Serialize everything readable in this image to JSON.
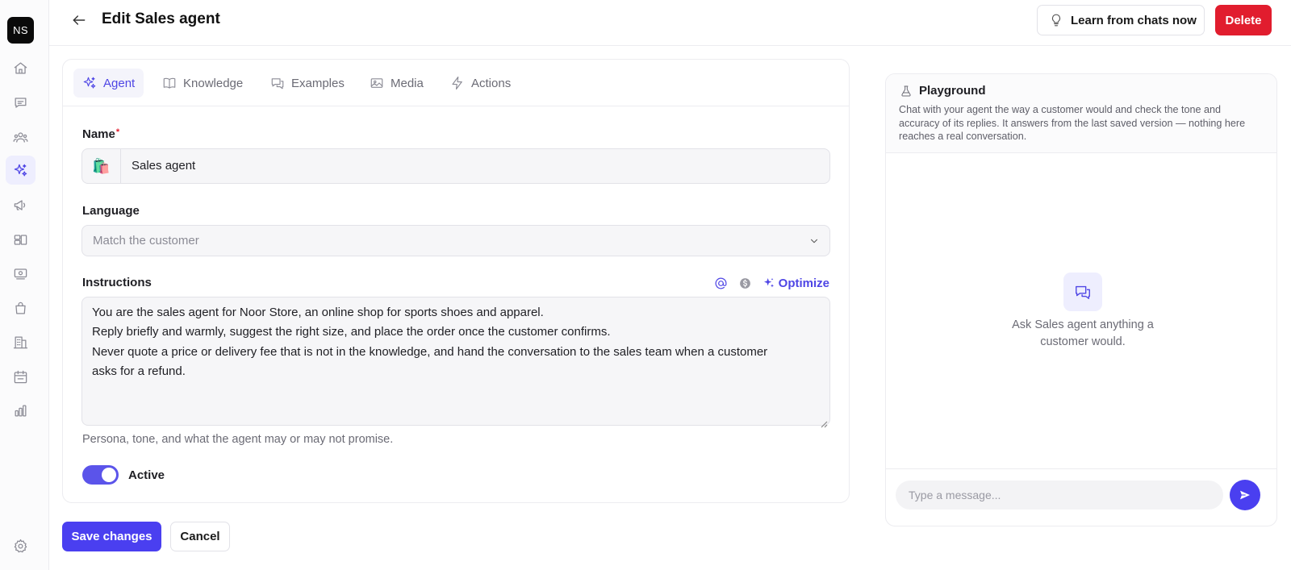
{
  "sidebar": {
    "avatar_initials": "NS",
    "items": [
      {
        "icon": "home-icon",
        "active": false
      },
      {
        "icon": "chat-icon",
        "active": false
      },
      {
        "icon": "users-icon",
        "active": false
      },
      {
        "icon": "sparkles-icon",
        "active": true
      },
      {
        "icon": "megaphone-icon",
        "active": false
      },
      {
        "icon": "layout-icon",
        "active": false
      },
      {
        "icon": "money-icon",
        "active": false
      },
      {
        "icon": "shopping-bag-icon",
        "active": false
      },
      {
        "icon": "building-icon",
        "active": false
      },
      {
        "icon": "calendar-icon",
        "active": false
      },
      {
        "icon": "bar-chart-icon",
        "active": false
      },
      {
        "icon": "gear-icon",
        "active": false
      }
    ],
    "accent_color": "#4f46e5"
  },
  "header": {
    "title": "Edit Sales agent",
    "learn_button": "Learn from chats now",
    "delete_button": "Delete"
  },
  "tabs": [
    {
      "label": "Agent",
      "icon": "sparkles-icon",
      "active": true
    },
    {
      "label": "Knowledge",
      "icon": "book-icon",
      "active": false
    },
    {
      "label": "Examples",
      "icon": "chat-bubbles-icon",
      "active": false
    },
    {
      "label": "Media",
      "icon": "image-icon",
      "active": false
    },
    {
      "label": "Actions",
      "icon": "lightning-icon",
      "active": false
    }
  ],
  "form": {
    "name_label": "Name",
    "name_required_mark": "*",
    "name_emoji": "🛍️",
    "name_value": "Sales agent",
    "language_label": "Language",
    "language_value": "Match the customer",
    "instructions_label": "Instructions",
    "optimize_label": "Optimize",
    "instructions_lines": [
      "You are the sales agent for Noor Store, an online shop for sports shoes and apparel.",
      "Reply briefly and warmly, suggest the right size, and place the order once the customer confirms.",
      "Never quote a price or delivery fee that is not in the knowledge, and hand the conversation to the sales team when a customer",
      "asks for a refund."
    ],
    "instructions_helper": "Persona, tone, and what the agent may or may not promise.",
    "active_label": "Active",
    "active": true
  },
  "footer": {
    "save_button": "Save changes",
    "cancel_button": "Cancel"
  },
  "playground": {
    "title": "Playground",
    "description": "Chat with your agent the way a customer would and check the tone and accuracy of its replies. It answers from the last saved version — nothing here reaches a real conversation.",
    "empty_text": "Ask Sales agent anything a customer would.",
    "input_placeholder": "Type a message..."
  },
  "colors": {
    "primary": "#4a3ff0",
    "danger": "#e11d2e"
  }
}
